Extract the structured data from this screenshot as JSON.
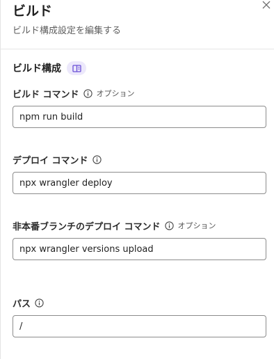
{
  "header": {
    "title": "ビルド",
    "subtitle": "ビルド構成設定を編集する"
  },
  "section": {
    "title": "ビルド構成"
  },
  "fields": [
    {
      "label": "ビルド コマンド",
      "optional": "オプション",
      "value": "npm run build"
    },
    {
      "label": "デプロイ コマンド",
      "optional": "",
      "value": "npx wrangler deploy"
    },
    {
      "label": "非本番ブランチのデプロイ コマンド",
      "optional": "オプション",
      "value": "npx wrangler versions upload"
    },
    {
      "label": "パス",
      "optional": "",
      "value": "/"
    }
  ],
  "icons": {
    "close": "close-icon",
    "docs": "book-icon",
    "info": "info-icon"
  },
  "colors": {
    "badge_bg": "#ece8fb",
    "badge_icon": "#6a4fd6",
    "input_border": "#8c8c8c"
  }
}
